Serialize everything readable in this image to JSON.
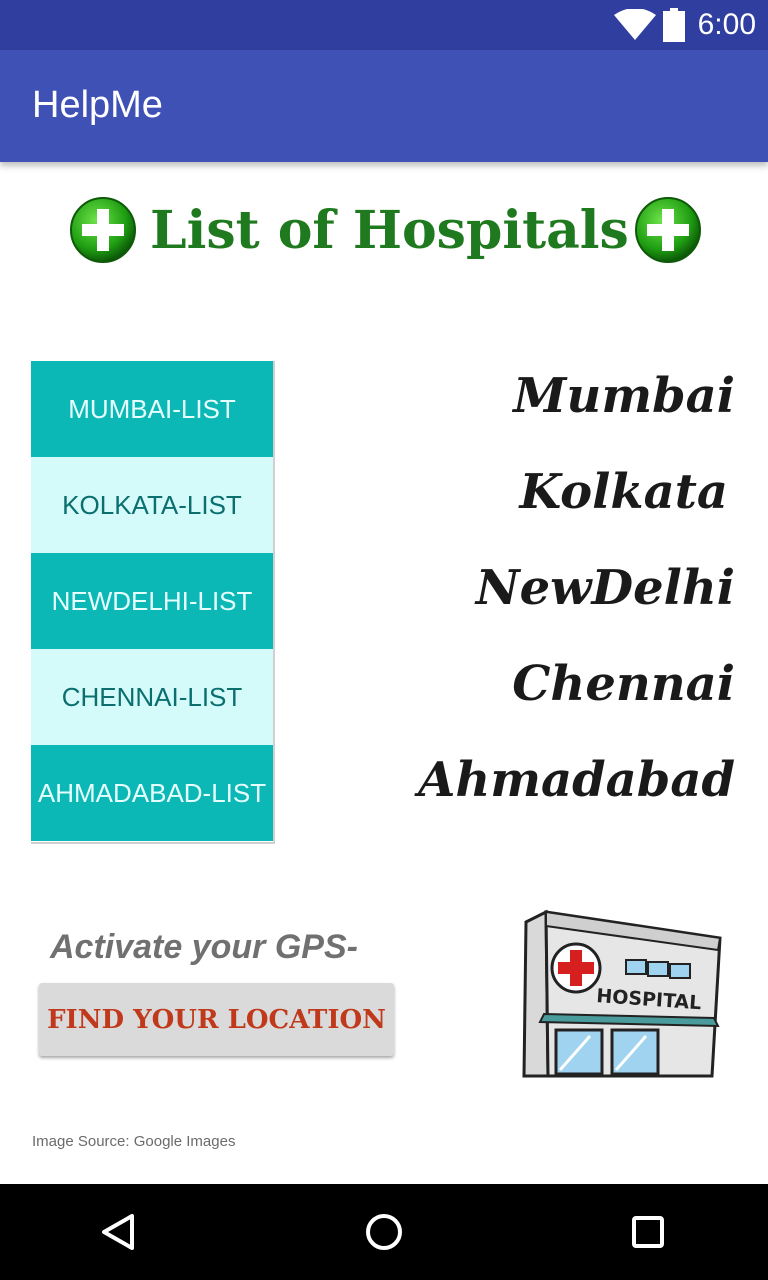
{
  "status_bar": {
    "time": "6:00",
    "icons": [
      "wifi-icon",
      "battery-icon"
    ],
    "color": "#303F9F"
  },
  "app_bar": {
    "title": "HelpMe",
    "color": "#3F51B5"
  },
  "header": {
    "title": "List of Hospitals",
    "icon": "plus-icon",
    "title_color": "#1f7a1f"
  },
  "lists": [
    {
      "label": "MUMBAI-LIST",
      "style": "dark"
    },
    {
      "label": "KOLKATA-LIST",
      "style": "light"
    },
    {
      "label": "NEWDELHI-LIST",
      "style": "dark"
    },
    {
      "label": "CHENNAI-LIST",
      "style": "light"
    },
    {
      "label": "AHMADABAD-LIST",
      "style": "dark"
    }
  ],
  "cities": [
    "Mumbai",
    "Kolkata",
    "NewDelhi",
    "Chennai",
    "Ahmadabad"
  ],
  "gps": {
    "prompt": "Activate your GPS-",
    "button_label": "FIND YOUR LOCATION"
  },
  "illustration": {
    "sign_text": "HOSPITAL",
    "icon": "hospital-building-icon"
  },
  "footer": {
    "image_source": "Image Source: Google Images"
  },
  "nav_bar": {
    "buttons": [
      "back-icon",
      "home-icon",
      "recent-apps-icon"
    ]
  },
  "colors": {
    "accent_dark": "#0CB8B6",
    "accent_light": "#D4FAFA",
    "button_text": "#C0391B"
  }
}
